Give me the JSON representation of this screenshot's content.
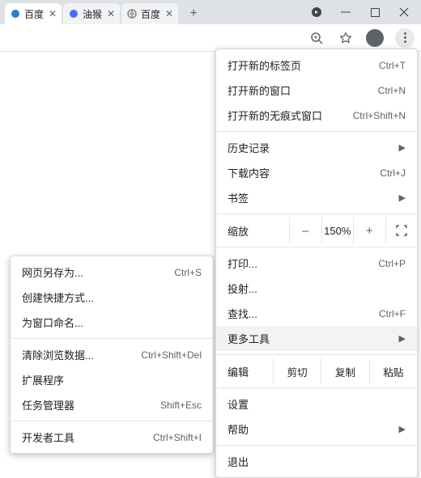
{
  "tabs": [
    {
      "label": "百度",
      "icon_color": "#2b7cd3"
    },
    {
      "label": "油猴",
      "icon_color": "#4f6df5"
    },
    {
      "label": "百度",
      "icon_color": "#8a8a8a"
    }
  ],
  "toolbar": {
    "zoom_icon": "zoom",
    "star_icon": "star"
  },
  "main_menu": {
    "g1": [
      {
        "label": "打开新的标签页",
        "shortcut": "Ctrl+T"
      },
      {
        "label": "打开新的窗口",
        "shortcut": "Ctrl+N"
      },
      {
        "label": "打开新的无痕式窗口",
        "shortcut": "Ctrl+Shift+N"
      }
    ],
    "g2": [
      {
        "label": "历史记录",
        "shortcut": "",
        "submenu": true
      },
      {
        "label": "下载内容",
        "shortcut": "Ctrl+J"
      },
      {
        "label": "书签",
        "shortcut": "",
        "submenu": true
      }
    ],
    "zoom": {
      "label": "缩放",
      "value": "150%",
      "minus": "–",
      "plus": "+"
    },
    "g3": [
      {
        "label": "打印...",
        "shortcut": "Ctrl+P"
      },
      {
        "label": "投射...",
        "shortcut": ""
      },
      {
        "label": "查找...",
        "shortcut": "Ctrl+F"
      },
      {
        "label": "更多工具",
        "shortcut": "",
        "submenu": true,
        "highlight": true
      }
    ],
    "edit": {
      "label": "编辑",
      "cut": "剪切",
      "copy": "复制",
      "paste": "粘贴"
    },
    "g4": [
      {
        "label": "设置"
      },
      {
        "label": "帮助",
        "submenu": true
      }
    ],
    "g5": [
      {
        "label": "退出"
      }
    ]
  },
  "sub_menu": {
    "g1": [
      {
        "label": "网页另存为...",
        "shortcut": "Ctrl+S"
      },
      {
        "label": "创建快捷方式..."
      },
      {
        "label": "为窗口命名..."
      }
    ],
    "g2": [
      {
        "label": "清除浏览数据...",
        "shortcut": "Ctrl+Shift+Del"
      },
      {
        "label": "扩展程序"
      },
      {
        "label": "任务管理器",
        "shortcut": "Shift+Esc"
      }
    ],
    "g3": [
      {
        "label": "开发者工具",
        "shortcut": "Ctrl+Shift+I"
      }
    ]
  }
}
